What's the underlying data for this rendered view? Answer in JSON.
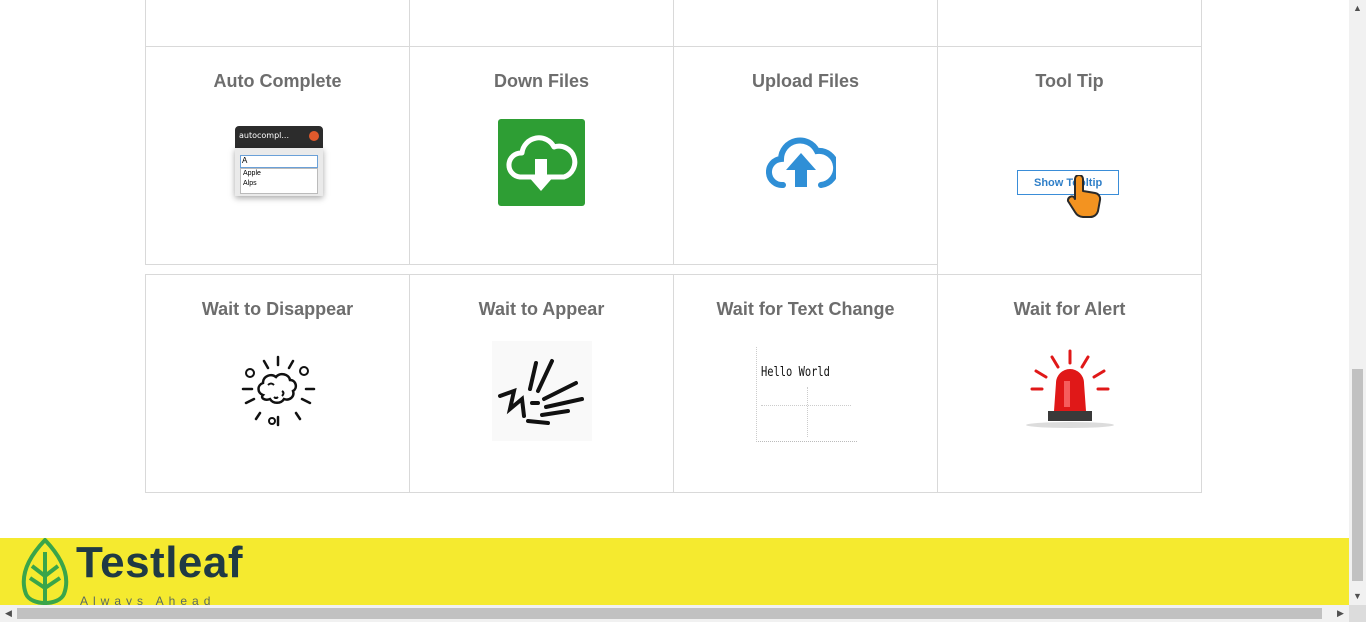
{
  "cards": [
    {
      "id": "auto-complete",
      "title": "Auto Complete"
    },
    {
      "id": "down-files",
      "title": "Down Files"
    },
    {
      "id": "upload-files",
      "title": "Upload Files"
    },
    {
      "id": "tool-tip",
      "title": "Tool Tip"
    },
    {
      "id": "wait-to-disappear",
      "title": "Wait to Disappear"
    },
    {
      "id": "wait-to-appear",
      "title": "Wait to Appear"
    },
    {
      "id": "wait-for-text-change",
      "title": "Wait for Text Change"
    },
    {
      "id": "wait-for-alert",
      "title": "Wait for Alert"
    }
  ],
  "autocomplete_art": {
    "window_title": "autocompl...",
    "input_value": "A",
    "options": [
      "Apple",
      "Alps"
    ]
  },
  "tooltip_art": {
    "button_label": "Show Tooltip"
  },
  "text_change_art": {
    "text": "Hello World"
  },
  "footer": {
    "brand": "Testleaf",
    "tagline": "Always Ahead",
    "background": "#f5ea2f",
    "brand_color": "#203a44",
    "leaf_color": "#3aa54a"
  },
  "colors": {
    "download_green": "#2e9e34",
    "upload_blue": "#2f8fd6",
    "alert_red": "#e01818",
    "hand_orange": "#f39320"
  }
}
